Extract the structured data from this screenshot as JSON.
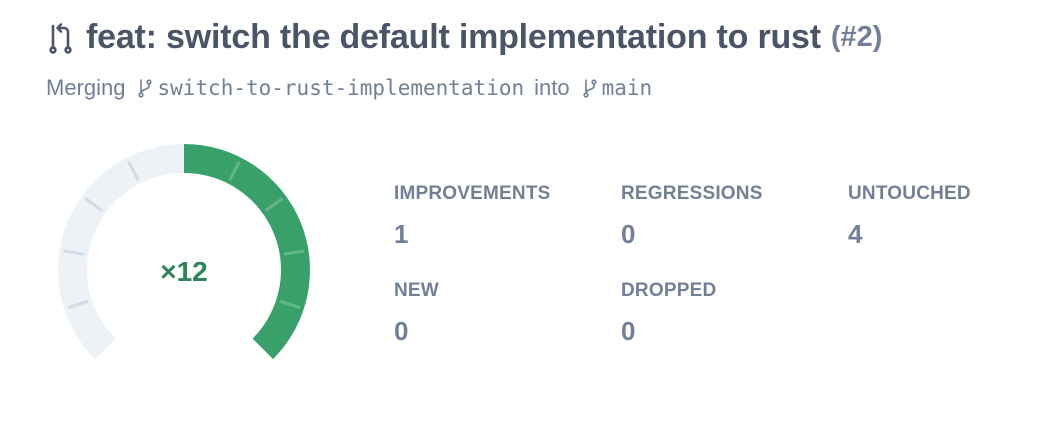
{
  "pull_request": {
    "title": "feat: switch the default implementation to rust",
    "number": "(#2)",
    "merging_label": "Merging",
    "source_branch": "switch-to-rust-implementation",
    "into_label": "into",
    "target_branch": "main"
  },
  "gauge": {
    "label": "×12",
    "fraction": 0.5,
    "color_filled": "#38a169",
    "color_track": "#edf2f7",
    "label_color": "#2f855a"
  },
  "stats": [
    {
      "key": "improvements",
      "label": "IMPROVEMENTS",
      "value": "1"
    },
    {
      "key": "regressions",
      "label": "REGRESSIONS",
      "value": "0"
    },
    {
      "key": "untouched",
      "label": "UNTOUCHED",
      "value": "4"
    },
    {
      "key": "new",
      "label": "NEW",
      "value": "0"
    },
    {
      "key": "dropped",
      "label": "DROPPED",
      "value": "0"
    }
  ],
  "icons": {
    "title": "git-pull-request-icon",
    "branch": "git-branch-icon"
  }
}
